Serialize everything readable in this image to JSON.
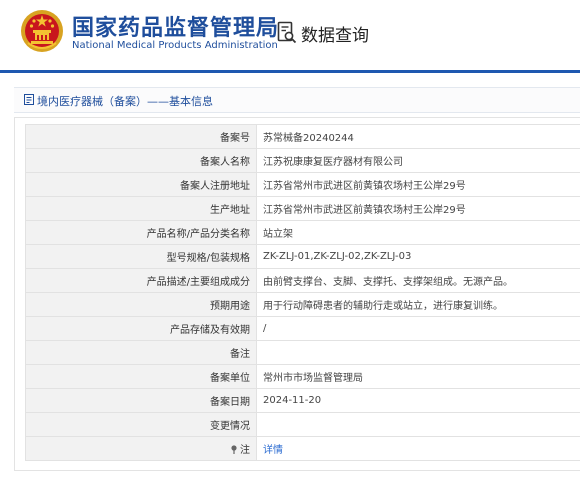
{
  "header": {
    "org_name_cn": "国家药品监督管理局",
    "org_name_en": "National Medical Products Administration",
    "query_label": "数据查询"
  },
  "breadcrumb": {
    "text": "境内医疗器械（备案）——基本信息"
  },
  "record": {
    "rows": [
      {
        "label": "备案号",
        "value": "苏常械备20240244"
      },
      {
        "label": "备案人名称",
        "value": "江苏祝康康复医疗器材有限公司"
      },
      {
        "label": "备案人注册地址",
        "value": "江苏省常州市武进区前黄镇农场村王公岸29号"
      },
      {
        "label": "生产地址",
        "value": "江苏省常州市武进区前黄镇农场村王公岸29号"
      },
      {
        "label": "产品名称/产品分类名称",
        "value": "站立架"
      },
      {
        "label": "型号规格/包装规格",
        "value": "ZK-ZLJ-01,ZK-ZLJ-02,ZK-ZLJ-03"
      },
      {
        "label": "产品描述/主要组成成分",
        "value": "由前臂支撑台、支脚、支撑托、支撑架组成。无源产品。"
      },
      {
        "label": "预期用途",
        "value": "用于行动障碍患者的辅助行走或站立，进行康复训练。"
      },
      {
        "label": "产品存储及有效期",
        "value": "/"
      },
      {
        "label": "备注",
        "value": ""
      },
      {
        "label": "备案单位",
        "value": "常州市市场监督管理局"
      },
      {
        "label": "备案日期",
        "value": "2024-11-20"
      },
      {
        "label": "变更情况",
        "value": ""
      }
    ],
    "note_row": {
      "label": "注",
      "link_text": "详情"
    }
  }
}
